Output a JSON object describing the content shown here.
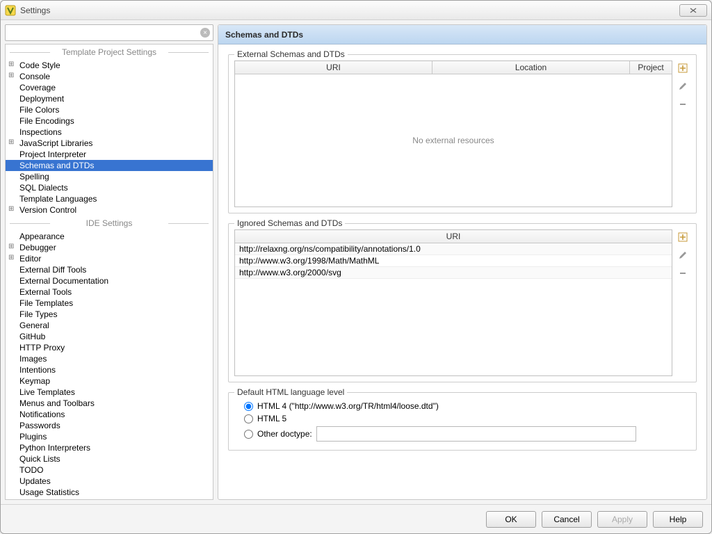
{
  "window": {
    "title": "Settings"
  },
  "search": {
    "placeholder": ""
  },
  "sections": {
    "template": {
      "header": "Template Project Settings",
      "items": [
        {
          "label": "Code Style",
          "exp": true
        },
        {
          "label": "Console",
          "exp": true
        },
        {
          "label": "Coverage"
        },
        {
          "label": "Deployment"
        },
        {
          "label": "File Colors"
        },
        {
          "label": "File Encodings"
        },
        {
          "label": "Inspections"
        },
        {
          "label": "JavaScript Libraries",
          "exp": true
        },
        {
          "label": "Project Interpreter"
        },
        {
          "label": "Schemas and DTDs",
          "selected": true
        },
        {
          "label": "Spelling"
        },
        {
          "label": "SQL Dialects"
        },
        {
          "label": "Template Languages"
        },
        {
          "label": "Version Control",
          "exp": true
        }
      ]
    },
    "ide": {
      "header": "IDE Settings",
      "items": [
        {
          "label": "Appearance"
        },
        {
          "label": "Debugger",
          "exp": true
        },
        {
          "label": "Editor",
          "exp": true
        },
        {
          "label": "External Diff Tools"
        },
        {
          "label": "External Documentation"
        },
        {
          "label": "External Tools"
        },
        {
          "label": "File Templates"
        },
        {
          "label": "File Types"
        },
        {
          "label": "General"
        },
        {
          "label": "GitHub"
        },
        {
          "label": "HTTP Proxy"
        },
        {
          "label": "Images"
        },
        {
          "label": "Intentions"
        },
        {
          "label": "Keymap"
        },
        {
          "label": "Live Templates"
        },
        {
          "label": "Menus and Toolbars"
        },
        {
          "label": "Notifications"
        },
        {
          "label": "Passwords"
        },
        {
          "label": "Plugins"
        },
        {
          "label": "Python Interpreters"
        },
        {
          "label": "Quick Lists"
        },
        {
          "label": "TODO"
        },
        {
          "label": "Updates"
        },
        {
          "label": "Usage Statistics"
        }
      ]
    }
  },
  "panel": {
    "title": "Schemas and DTDs",
    "external": {
      "legend": "External Schemas and DTDs",
      "cols": {
        "uri": "URI",
        "location": "Location",
        "project": "Project"
      },
      "empty": "No external resources"
    },
    "ignored": {
      "legend": "Ignored Schemas and DTDs",
      "col": "URI",
      "rows": [
        "http://relaxng.org/ns/compatibility/annotations/1.0",
        "http://www.w3.org/1998/Math/MathML",
        "http://www.w3.org/2000/svg"
      ]
    },
    "html": {
      "legend": "Default HTML language level",
      "opt1": "HTML 4 (\"http://www.w3.org/TR/html4/loose.dtd\")",
      "opt2": "HTML 5",
      "opt3": "Other doctype:"
    }
  },
  "footer": {
    "ok": "OK",
    "cancel": "Cancel",
    "apply": "Apply",
    "help": "Help"
  }
}
